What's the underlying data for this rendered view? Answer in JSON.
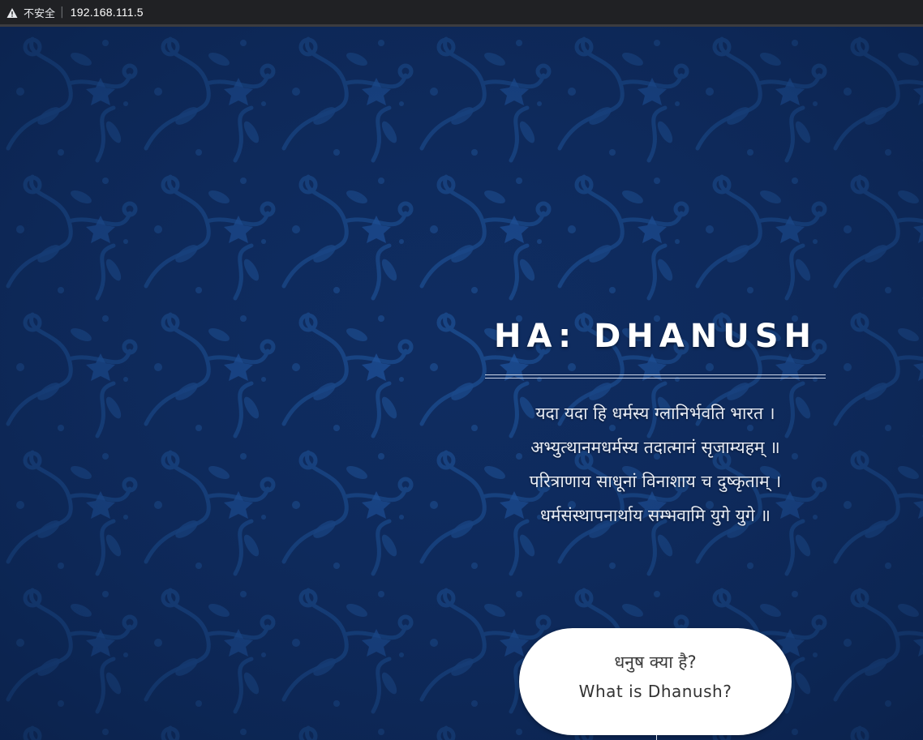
{
  "browser": {
    "security_label": "不安全",
    "url": "192.168.111.5",
    "icon": "warning-triangle-icon"
  },
  "hero": {
    "title": "HA: DHANUSH",
    "verse": [
      "यदा यदा हि धर्मस्य ग्लानिर्भवति भारत ।",
      "अभ्युत्थानमधर्मस्य तदात्मानं सृजाम्यहम् ॥",
      "परित्राणाय साधूनां विनाशाय च दुष्कृताम् ।",
      "धर्मसंस्थापनार्थाय सम्भवामि युगे युगे ॥"
    ]
  },
  "cta": {
    "hindi_label": "धनुष क्या है?",
    "english_label": "What is Dhanush?"
  },
  "colors": {
    "background": "#0d2a5b",
    "pattern": "#1c4e93",
    "browser_bar": "#202124"
  }
}
